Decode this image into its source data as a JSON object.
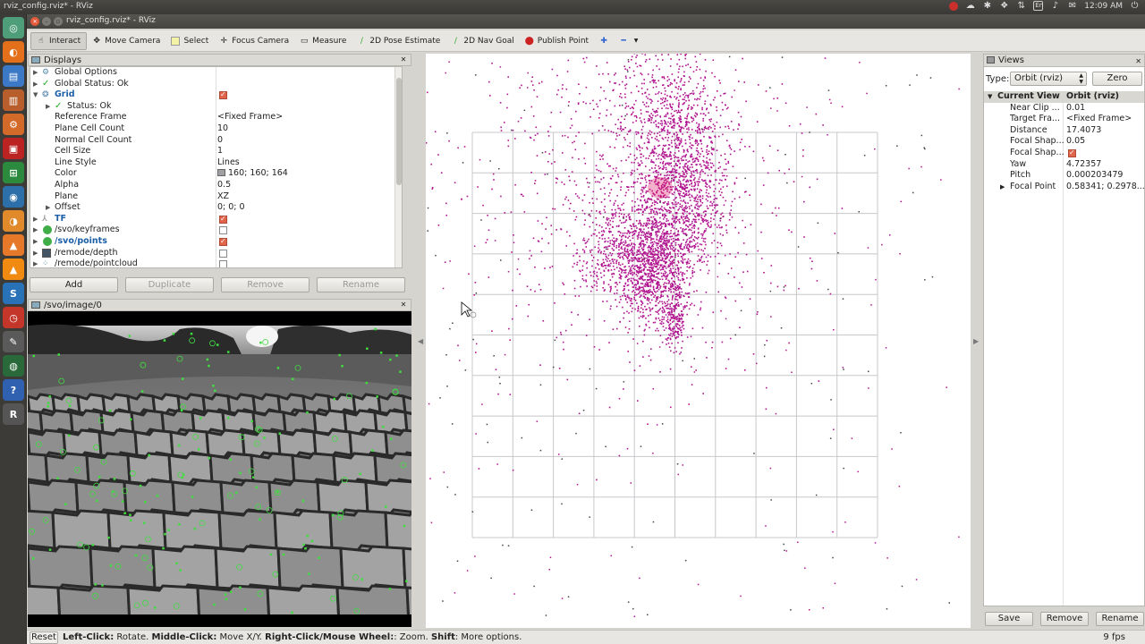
{
  "system": {
    "title": "rviz_config.rviz* - RViz",
    "time": "12:09 AM",
    "lang": "En"
  },
  "window": {
    "title": "rviz_config.rviz* - RViz"
  },
  "toolbar": {
    "tools": [
      {
        "label": "Interact",
        "icon": "interact-icon"
      },
      {
        "label": "Move Camera",
        "icon": "move-camera-icon"
      },
      {
        "label": "Select",
        "icon": "select-icon"
      },
      {
        "label": "Focus Camera",
        "icon": "focus-camera-icon"
      },
      {
        "label": "Measure",
        "icon": "measure-icon"
      },
      {
        "label": "2D Pose Estimate",
        "icon": "pose-estimate-icon"
      },
      {
        "label": "2D Nav Goal",
        "icon": "nav-goal-icon"
      },
      {
        "label": "Publish Point",
        "icon": "publish-point-icon"
      }
    ]
  },
  "displays": {
    "title": "Displays",
    "rows": [
      {
        "label": "Global Options",
        "value": ""
      },
      {
        "label": "Global Status: Ok",
        "value": ""
      },
      {
        "label": "Grid",
        "value": ""
      },
      {
        "label": "Status: Ok",
        "value": ""
      },
      {
        "label": "Reference Frame",
        "value": "<Fixed Frame>"
      },
      {
        "label": "Plane Cell Count",
        "value": "10"
      },
      {
        "label": "Normal Cell Count",
        "value": "0"
      },
      {
        "label": "Cell Size",
        "value": "1"
      },
      {
        "label": "Line Style",
        "value": "Lines"
      },
      {
        "label": "Color",
        "value": "160; 160; 164"
      },
      {
        "label": "Alpha",
        "value": "0.5"
      },
      {
        "label": "Plane",
        "value": "XZ"
      },
      {
        "label": "Offset",
        "value": "0; 0; 0"
      },
      {
        "label": "TF",
        "value": ""
      },
      {
        "label": "/svo/keyframes",
        "value": ""
      },
      {
        "label": "/svo/points",
        "value": ""
      },
      {
        "label": "/remode/depth",
        "value": ""
      },
      {
        "label": "/remode/pointcloud",
        "value": ""
      }
    ],
    "buttons": {
      "add": "Add",
      "duplicate": "Duplicate",
      "remove": "Remove",
      "rename": "Rename"
    }
  },
  "image_panel": {
    "title": "/svo/image/0"
  },
  "views": {
    "title": "Views",
    "type_label": "Type:",
    "type_value": "Orbit (rviz)",
    "zero": "Zero",
    "header": {
      "label": "Current View",
      "value": "Orbit (rviz)"
    },
    "rows": [
      {
        "label": "Near Clip ...",
        "value": "0.01"
      },
      {
        "label": "Target Fra...",
        "value": "<Fixed Frame>"
      },
      {
        "label": "Distance",
        "value": "17.4073"
      },
      {
        "label": "Focal Shap...",
        "value": "0.05"
      },
      {
        "label": "Focal Shap...",
        "value": ""
      },
      {
        "label": "Yaw",
        "value": "4.72357"
      },
      {
        "label": "Pitch",
        "value": "0.000203479"
      },
      {
        "label": "Focal Point",
        "value": "0.58341; 0.2978..."
      }
    ],
    "buttons": {
      "save": "Save",
      "remove": "Remove",
      "rename": "Rename"
    }
  },
  "status": {
    "reset": "Reset",
    "help_b1": "Left-Click:",
    "help_t1": " Rotate. ",
    "help_b2": "Middle-Click:",
    "help_t2": " Move X/Y. ",
    "help_b3": "Right-Click/Mouse Wheel:",
    "help_t3": ": Zoom. ",
    "help_b4": "Shift",
    "help_t4": ": More options.",
    "fps": "9 fps"
  },
  "colors": {
    "points": "#b0148f",
    "grid": "#a0a0a4",
    "feature": "#3fdd3f",
    "accent": "#e0654a"
  }
}
